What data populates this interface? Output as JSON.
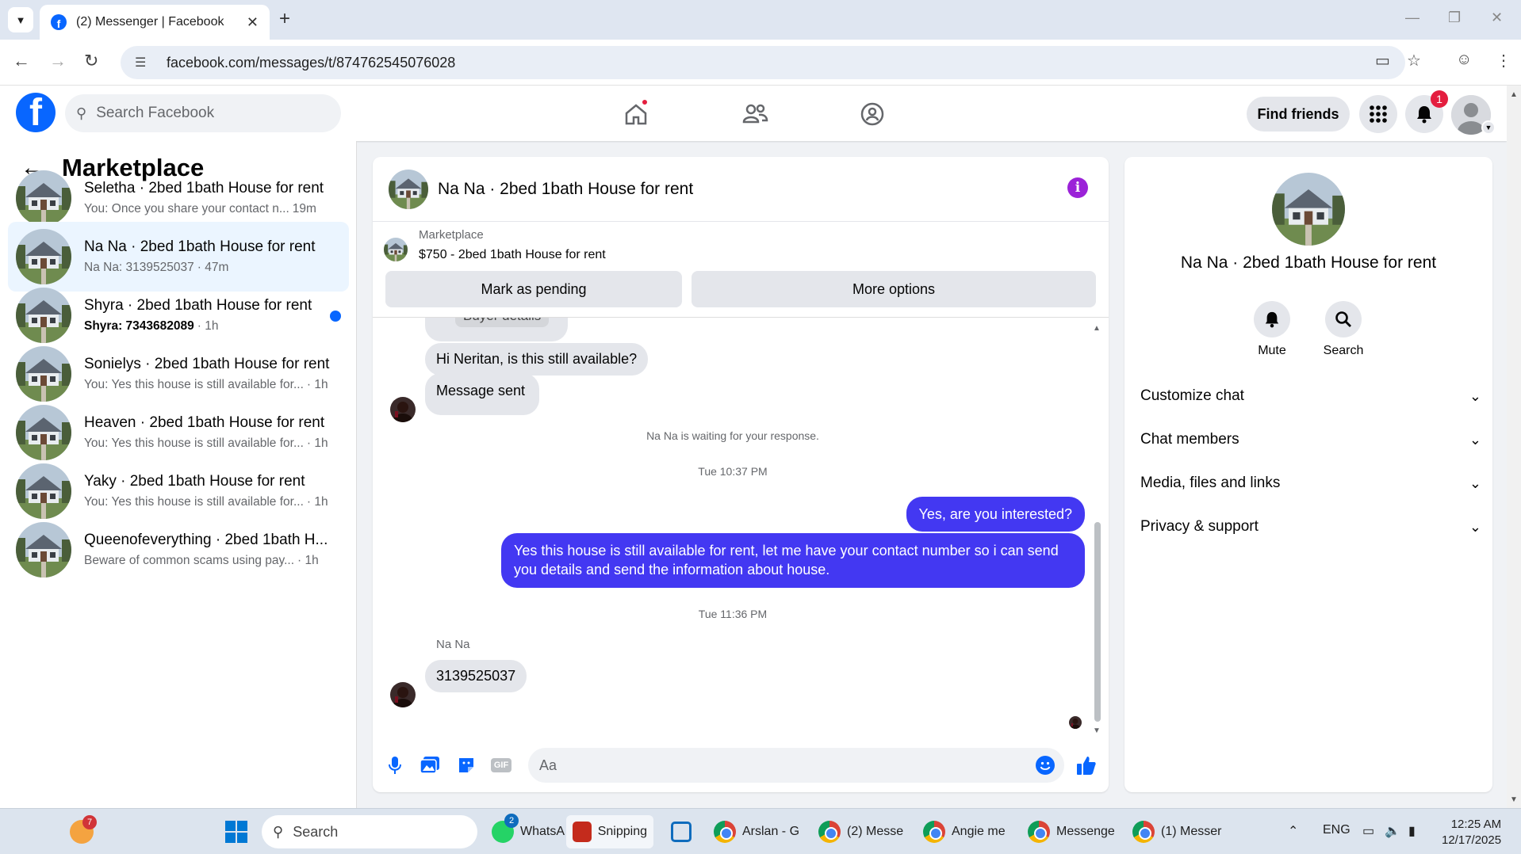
{
  "browser": {
    "tab_title": "(2) Messenger | Facebook",
    "url": "facebook.com/messages/t/874762545076028"
  },
  "header": {
    "search_placeholder": "Search Facebook",
    "find_friends": "Find friends",
    "notification_count": "1"
  },
  "sidebar": {
    "title": "Marketplace",
    "conversations": [
      {
        "name": "Seletha · 2bed 1bath House for rent",
        "preview": "You: Once you share your contact n...",
        "time": "19m",
        "active": false,
        "unread": false
      },
      {
        "name": "Na Na · 2bed 1bath House for rent",
        "preview": "Na Na: 3139525037",
        "time": "· 47m",
        "active": true,
        "unread": false
      },
      {
        "name": "Shyra · 2bed 1bath House for rent",
        "preview": "Shyra: 7343682089",
        "time": "· 1h",
        "active": false,
        "unread": true
      },
      {
        "name": "Sonielys · 2bed 1bath House for rent",
        "preview": "You: Yes this house is still available for...",
        "time": "· 1h",
        "active": false,
        "unread": false
      },
      {
        "name": "Heaven · 2bed 1bath House for rent",
        "preview": "You: Yes this house is still available for...",
        "time": "· 1h",
        "active": false,
        "unread": false
      },
      {
        "name": "Yaky · 2bed 1bath House for rent",
        "preview": "You: Yes this house is still available for...",
        "time": "· 1h",
        "active": false,
        "unread": false
      },
      {
        "name": "Queenofeverything · 2bed 1bath H...",
        "preview": "Beware of common scams using pay...",
        "time": "· 1h",
        "active": false,
        "unread": false
      }
    ]
  },
  "chat": {
    "title": "Na Na · 2bed 1bath House for rent",
    "marketplace_label": "Marketplace",
    "listing": "$750 - 2bed 1bath House for rent",
    "mark_pending": "Mark as pending",
    "more_options": "More options",
    "partial_bubble": "Buyer details",
    "msg_in_1": "Hi Neritan, is this still available?",
    "msg_in_2": "Message sent",
    "waiting": "Na Na is waiting for your response.",
    "ts_1": "Tue 10:37 PM",
    "msg_out_1": "Yes, are you interested?",
    "msg_out_2": "Yes this house is still available for rent, let me have your contact number so i can send you details and send the information about house.",
    "ts_2": "Tue 11:36 PM",
    "sender": "Na Na",
    "msg_in_3": "3139525037",
    "composer_placeholder": "Aa",
    "gif_label": "GIF"
  },
  "details": {
    "name": "Na Na · 2bed 1bath House for rent",
    "mute": "Mute",
    "search": "Search",
    "sections": [
      "Customize chat",
      "Chat members",
      "Media, files and links",
      "Privacy & support"
    ]
  },
  "taskbar": {
    "search": "Search",
    "whatsapp_badge": "2",
    "weather_badge": "7",
    "items": [
      "WhatsA",
      "Snipping",
      "Arslan - G",
      "(2) Messe",
      "Angie me",
      "Messenge",
      "(1) Messer"
    ],
    "lang": "ENG",
    "time": "12:25 AM",
    "date": "12/17/2025"
  },
  "colors": {
    "fb_blue": "#0866ff",
    "outgoing_bubble": "#4338f2",
    "incoming_bubble": "#e4e6eb",
    "info_purple": "#9b22d8"
  }
}
